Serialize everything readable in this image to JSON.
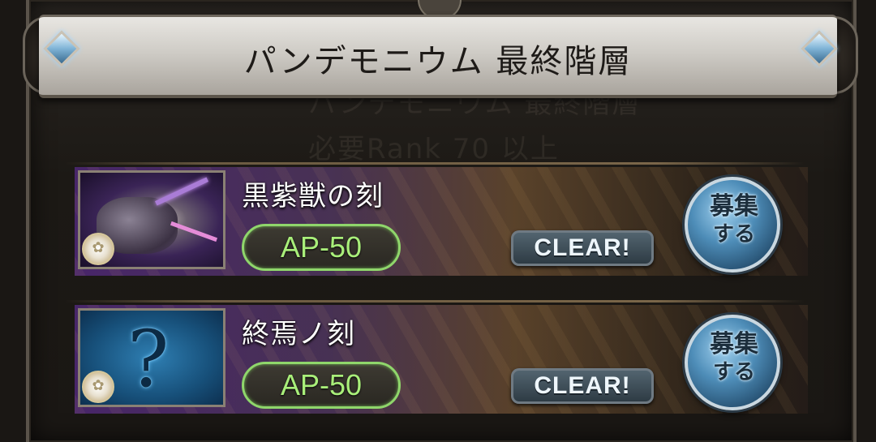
{
  "header": {
    "title": "パンデモニウム 最終階層"
  },
  "background_ghost": {
    "line1": "パンデモニウム 最終階層",
    "line2": "必要Rank 70 以上"
  },
  "quests": [
    {
      "name": "黒紫獣の刻",
      "ap_label": "AP-50",
      "status_label": "CLEAR!",
      "recruit_label_1": "募集",
      "recruit_label_2": "する",
      "thumbnail": "purple-beast-boss-icon"
    },
    {
      "name": "終焉ノ刻",
      "ap_label": "AP-50",
      "status_label": "CLEAR!",
      "recruit_label_1": "募集",
      "recruit_label_2": "する",
      "thumbnail": "blue-rune-icon"
    }
  ],
  "colors": {
    "ap_green": "#a9ef7a",
    "recruit_blue": "#4e8db8",
    "banner_silver": "#cfccc6"
  }
}
